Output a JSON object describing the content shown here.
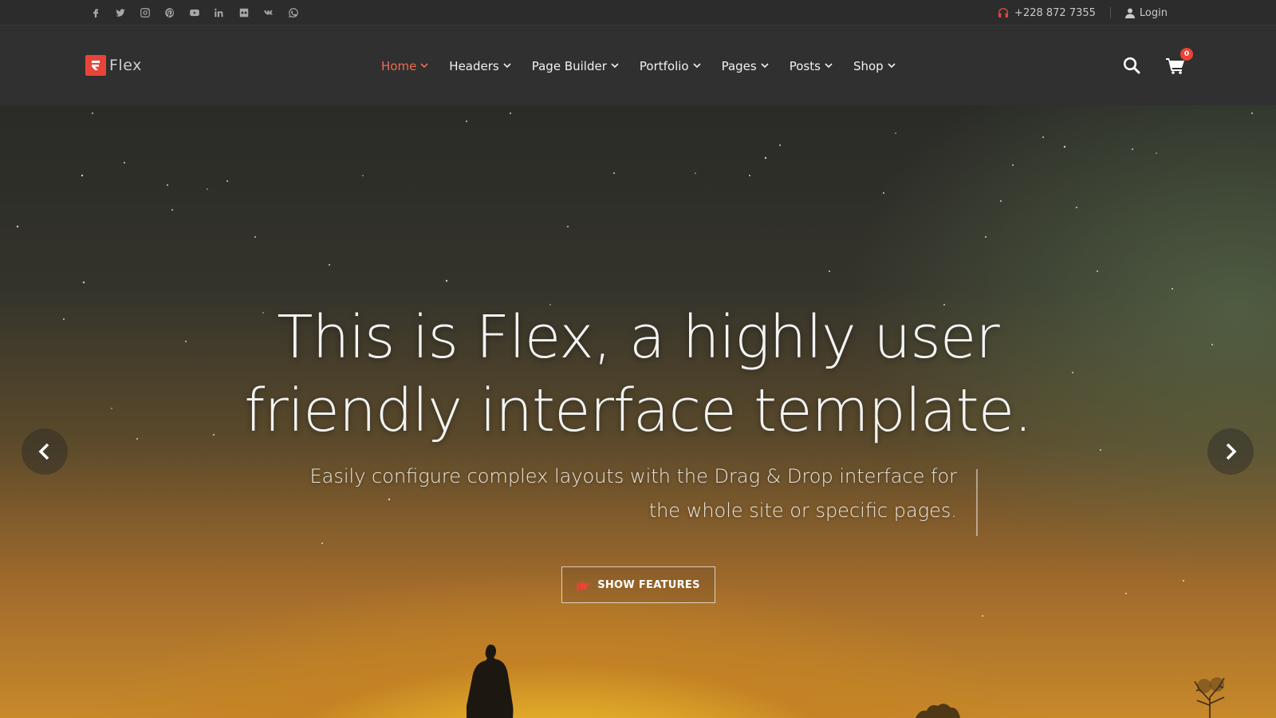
{
  "topbar": {
    "social": [
      {
        "name": "facebook-icon",
        "glyph": "f"
      },
      {
        "name": "twitter-icon",
        "glyph": ""
      },
      {
        "name": "instagram-icon",
        "glyph": ""
      },
      {
        "name": "pinterest-icon",
        "glyph": ""
      },
      {
        "name": "youtube-icon",
        "glyph": ""
      },
      {
        "name": "linkedin-icon",
        "glyph": "in"
      },
      {
        "name": "flickr-icon",
        "glyph": ""
      },
      {
        "name": "vk-icon",
        "glyph": "vk"
      },
      {
        "name": "whatsapp-icon",
        "glyph": ""
      }
    ],
    "phone": "+228 872 7355",
    "login_label": "Login"
  },
  "header": {
    "logo_text": "Flex",
    "nav": [
      {
        "label": "Home",
        "active": true
      },
      {
        "label": "Headers",
        "active": false
      },
      {
        "label": "Page Builder",
        "active": false
      },
      {
        "label": "Portfolio",
        "active": false
      },
      {
        "label": "Pages",
        "active": false
      },
      {
        "label": "Posts",
        "active": false
      },
      {
        "label": "Shop",
        "active": false
      }
    ],
    "cart_count": "0"
  },
  "hero": {
    "title_line1": "This is Flex, a highly user",
    "title_line2": "friendly interface template.",
    "subtitle_line1": "Easily configure complex layouts with the Drag & Drop interface for",
    "subtitle_line2": "the whole site or specific pages.",
    "cta_label": "SHOW FEATURES"
  },
  "colors": {
    "accent": "#e8443a",
    "nav_active": "#ef6b4f",
    "topbar_bg": "#2c2c2c",
    "header_bg": "#303030"
  }
}
